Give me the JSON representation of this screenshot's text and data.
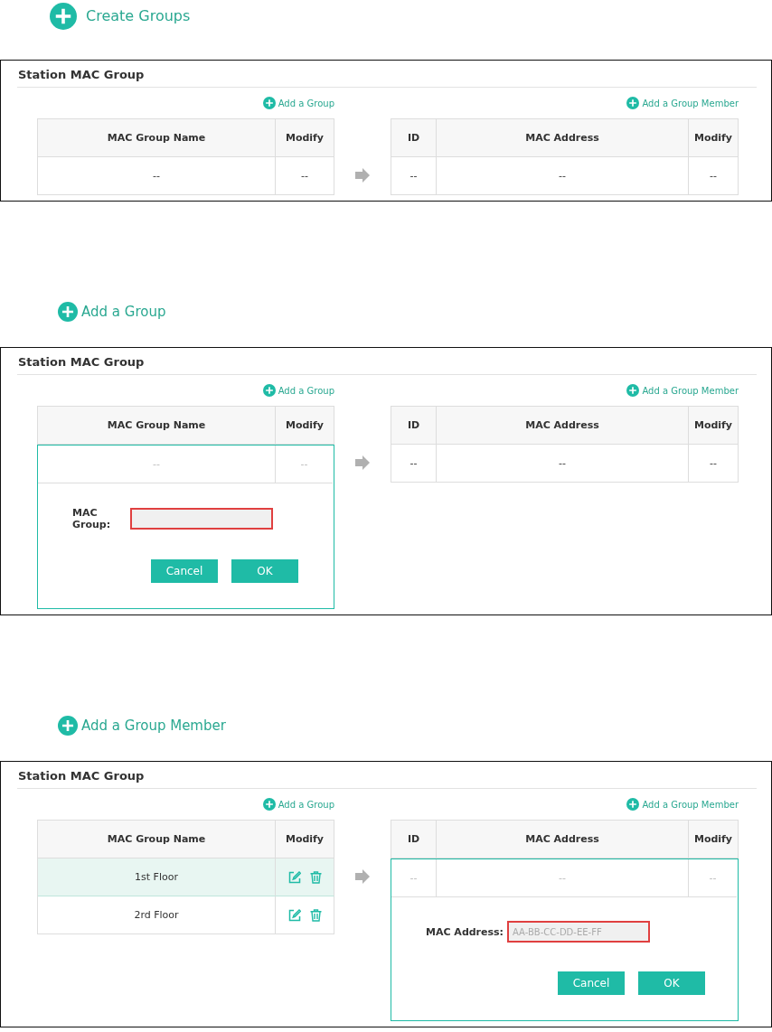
{
  "sections": [
    {
      "heading": "Create Groups",
      "panel": {
        "title": "Station MAC Group",
        "left": {
          "add_link": "Add a Group",
          "columns": [
            "MAC Group Name",
            "Modify"
          ],
          "rows": [
            {
              "selected": false,
              "cells": [
                {
                  "kind": "text",
                  "text": "--"
                },
                {
                  "kind": "text",
                  "text": "--"
                }
              ]
            }
          ]
        },
        "right": {
          "add_link": "Add a Group Member",
          "columns": [
            "ID",
            "MAC Address",
            "Modify"
          ],
          "rows": [
            {
              "selected": false,
              "cells": [
                {
                  "kind": "text",
                  "text": "--"
                },
                {
                  "kind": "text",
                  "text": "--"
                },
                {
                  "kind": "text",
                  "text": "--"
                }
              ]
            }
          ]
        }
      }
    },
    {
      "heading": "Add a Group",
      "panel": {
        "title": "Station MAC Group",
        "left": {
          "add_link": "Add a Group",
          "columns": [
            "MAC Group Name",
            "Modify"
          ],
          "rows": [
            {
              "selected": false,
              "cells": [
                {
                  "kind": "text",
                  "text": "--"
                },
                {
                  "kind": "text",
                  "text": "--"
                }
              ]
            }
          ],
          "editor": {
            "field": {
              "label": "MAC Group:"
            },
            "buttons": [
              "Cancel",
              "OK"
            ]
          }
        },
        "right": {
          "add_link": "Add a Group Member",
          "columns": [
            "ID",
            "MAC Address",
            "Modify"
          ],
          "rows": [
            {
              "selected": false,
              "cells": [
                {
                  "kind": "text",
                  "text": "--"
                },
                {
                  "kind": "text",
                  "text": "--"
                },
                {
                  "kind": "text",
                  "text": "--"
                }
              ]
            }
          ]
        }
      }
    },
    {
      "heading": "Add a Group Member",
      "panel": {
        "title": "Station MAC Group",
        "left": {
          "add_link": "Add a Group",
          "columns": [
            "MAC Group Name",
            "Modify"
          ],
          "rows": [
            {
              "selected": true,
              "cells": [
                {
                  "kind": "text",
                  "text": "1st Floor"
                },
                {
                  "kind": "actions"
                }
              ]
            },
            {
              "selected": false,
              "cells": [
                {
                  "kind": "text",
                  "text": "2rd Floor"
                },
                {
                  "kind": "actions"
                }
              ]
            }
          ]
        },
        "right": {
          "add_link": "Add a Group Member",
          "columns": [
            "ID",
            "MAC Address",
            "Modify"
          ],
          "rows": [
            {
              "selected": false,
              "cells": [
                {
                  "kind": "text",
                  "text": "--"
                },
                {
                  "kind": "text",
                  "text": "--"
                },
                {
                  "kind": "text",
                  "text": "--"
                }
              ]
            }
          ],
          "editor": {
            "field": {
              "label": "MAC Address:",
              "placeholder": "AA-BB-CC-DD-EE-FF"
            },
            "buttons": [
              "Cancel",
              "OK"
            ]
          }
        }
      }
    }
  ]
}
